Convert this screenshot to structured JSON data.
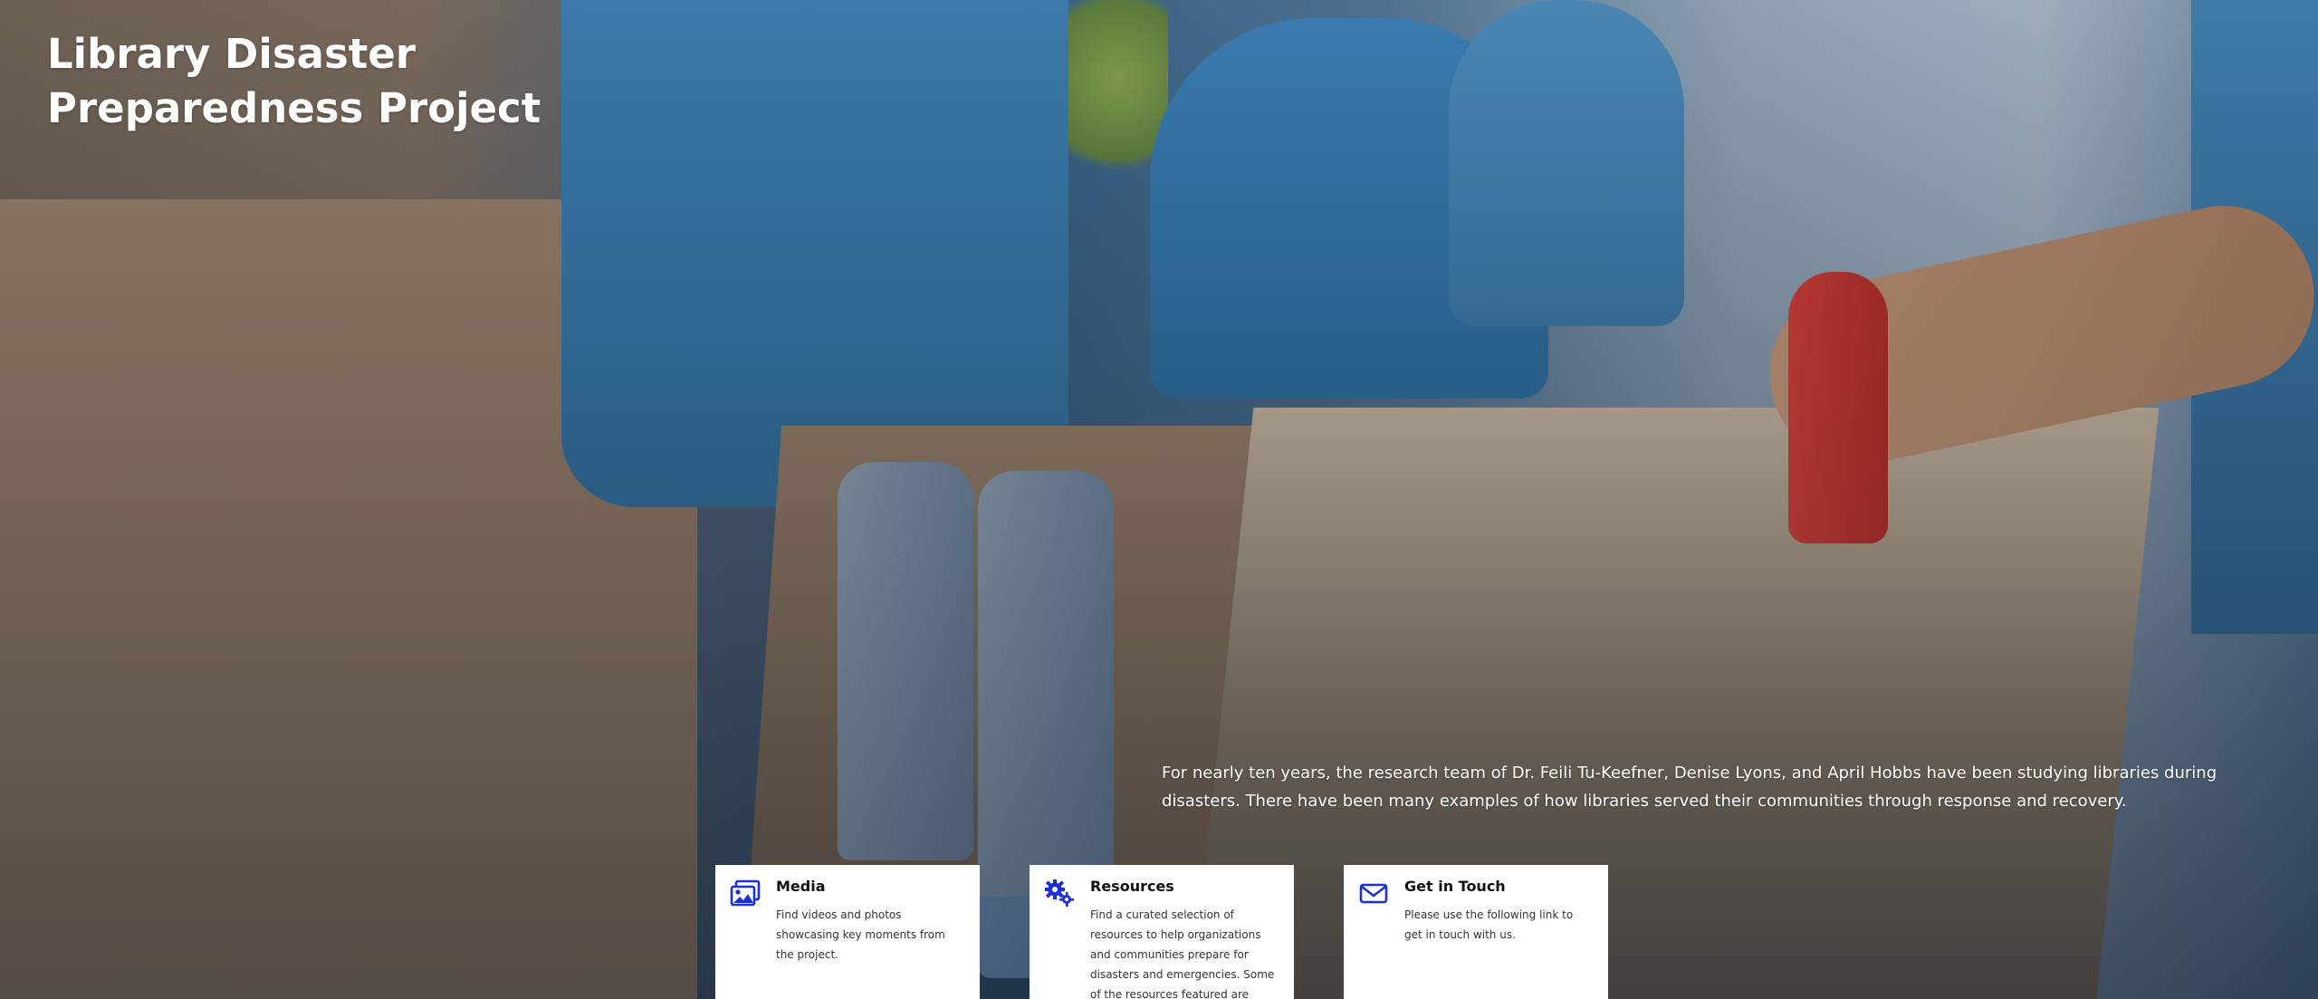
{
  "hero": {
    "title_line1": "Library Disaster",
    "title_line2": "Preparedness Project",
    "intro": "For nearly ten years, the research team of Dr. Feili Tu-Keefner, Denise Lyons, and April Hobbs have been studying libraries during disasters. There have been many examples of how libraries served their communities through response and recovery."
  },
  "cards": {
    "media": {
      "icon": "photos-icon",
      "title": "Media",
      "text": "Find videos and photos showcasing key moments from the project."
    },
    "resources": {
      "icon": "gears-icon",
      "title": "Resources",
      "text": "Find a curated selection of resources to help organizations and communities prepare for disasters and emergencies. Some of the resources featured are"
    },
    "contact": {
      "icon": "envelope-icon",
      "title": "Get in Touch",
      "text": "Please use the following link to get in touch with us."
    }
  },
  "colors": {
    "icon_accent": "#1d2fd6",
    "card_bg": "#ffffff",
    "hero_text": "#ffffff"
  }
}
